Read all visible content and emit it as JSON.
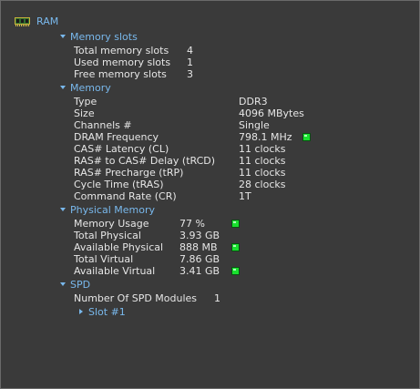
{
  "root": {
    "label": "RAM",
    "icon": "ram-chip-icon"
  },
  "memory_slots": {
    "header": "Memory slots",
    "rows": [
      {
        "label": "Total memory slots",
        "value": "4"
      },
      {
        "label": "Used memory slots",
        "value": "1"
      },
      {
        "label": "Free memory slots",
        "value": "3"
      }
    ]
  },
  "memory": {
    "header": "Memory",
    "rows": [
      {
        "label": "Type",
        "value": "DDR3"
      },
      {
        "label": "Size",
        "value": "4096 MBytes"
      },
      {
        "label": "Channels #",
        "value": "Single"
      },
      {
        "label": "DRAM Frequency",
        "value": "798.1 MHz"
      },
      {
        "label": "CAS# Latency (CL)",
        "value": "11 clocks"
      },
      {
        "label": "RAS# to CAS# Delay (tRCD)",
        "value": "11 clocks"
      },
      {
        "label": "RAS# Precharge (tRP)",
        "value": "11 clocks"
      },
      {
        "label": "Cycle Time (tRAS)",
        "value": "28 clocks"
      },
      {
        "label": "Command Rate (CR)",
        "value": "1T"
      }
    ]
  },
  "physical_memory": {
    "header": "Physical Memory",
    "rows": [
      {
        "label": "Memory Usage",
        "value": "77 %"
      },
      {
        "label": "Total Physical",
        "value": "3.93 GB"
      },
      {
        "label": "Available Physical",
        "value": "888 MB"
      },
      {
        "label": "Total Virtual",
        "value": "7.86 GB"
      },
      {
        "label": "Available Virtual",
        "value": "3.41 GB"
      }
    ]
  },
  "spd": {
    "header": "SPD",
    "modules": {
      "label": "Number Of SPD Modules",
      "value": "1"
    },
    "slot": {
      "label": "Slot #1"
    }
  },
  "colors": {
    "accent": "#79b8ec",
    "indicator": "#19e02e",
    "background": "#3a3a3a",
    "text": "#e6e6e6"
  }
}
